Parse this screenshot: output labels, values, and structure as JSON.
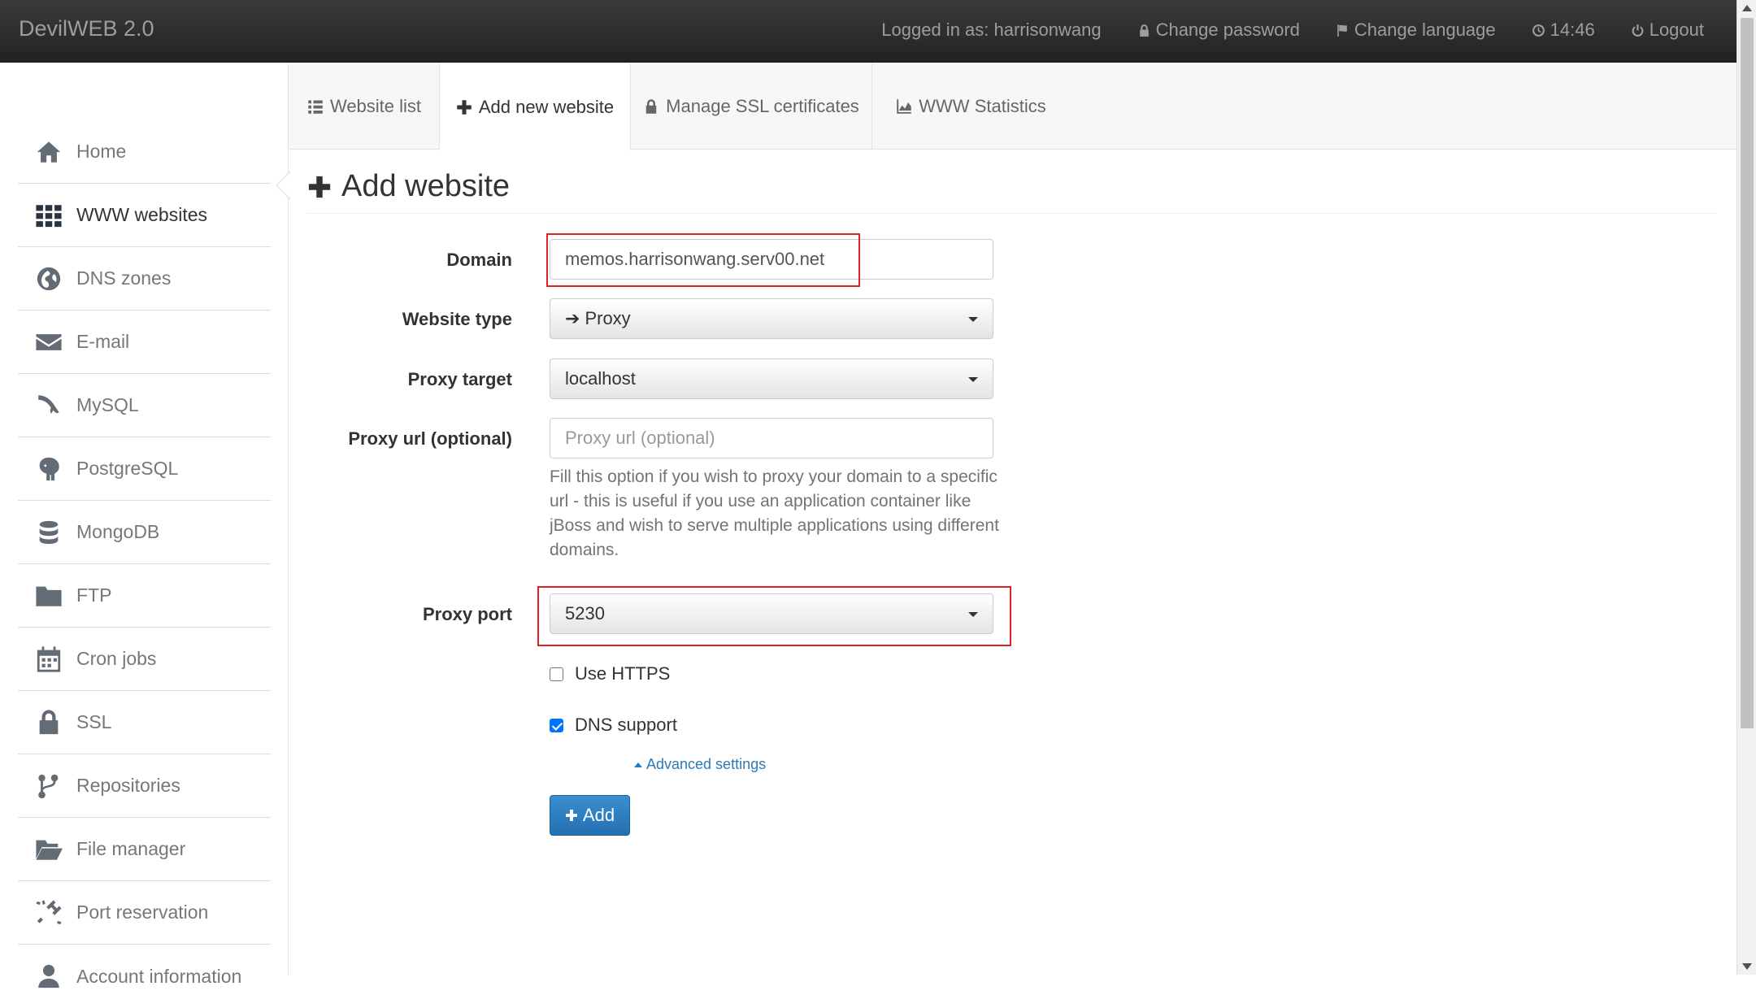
{
  "navbar": {
    "brand": "DevilWEB 2.0",
    "logged_in": "Logged in as: harrisonwang",
    "change_password": "Change password",
    "change_language": "Change language",
    "time": "14:46",
    "logout": "Logout"
  },
  "sidebar": {
    "items": [
      {
        "label": "Home",
        "icon": "home-icon"
      },
      {
        "label": "WWW websites",
        "icon": "grid-icon"
      },
      {
        "label": "DNS zones",
        "icon": "globe-icon"
      },
      {
        "label": "E-mail",
        "icon": "envelope-icon"
      },
      {
        "label": "MySQL",
        "icon": "dolphin-icon"
      },
      {
        "label": "PostgreSQL",
        "icon": "elephant-icon"
      },
      {
        "label": "MongoDB",
        "icon": "database-icon"
      },
      {
        "label": "FTP",
        "icon": "folder-icon"
      },
      {
        "label": "Cron jobs",
        "icon": "calendar-icon"
      },
      {
        "label": "SSL",
        "icon": "lock-icon"
      },
      {
        "label": "Repositories",
        "icon": "branch-icon"
      },
      {
        "label": "File manager",
        "icon": "folder-open-icon"
      },
      {
        "label": "Port reservation",
        "icon": "plug-icon"
      },
      {
        "label": "Account information",
        "icon": "user-icon"
      }
    ]
  },
  "tabs": {
    "website_list": "Website list",
    "add_new_website": "Add new website",
    "manage_ssl": "Manage SSL certificates",
    "www_statistics": "WWW Statistics"
  },
  "form": {
    "title": "Add website",
    "domain_label": "Domain",
    "domain_value": "memos.harrisonwang.serv00.net",
    "website_type_label": "Website type",
    "website_type_value": "Proxy",
    "proxy_target_label": "Proxy target",
    "proxy_target_value": "localhost",
    "proxy_url_label": "Proxy url (optional)",
    "proxy_url_placeholder": "Proxy url (optional)",
    "proxy_url_help": "Fill this option if you wish to proxy your domain to a specific url - this is useful if you use an application container like jBoss and wish to serve multiple applications using different domains.",
    "proxy_port_label": "Proxy port",
    "proxy_port_value": "5230",
    "use_https_label": "Use HTTPS",
    "use_https_checked": false,
    "dns_support_label": "DNS support",
    "dns_support_checked": true,
    "advanced_settings": "Advanced settings",
    "add_button": "Add"
  },
  "colors": {
    "highlight_box": "#e0202a",
    "primary_button": "#2a7ab8",
    "navbar_bg": "#2b2b2b"
  }
}
